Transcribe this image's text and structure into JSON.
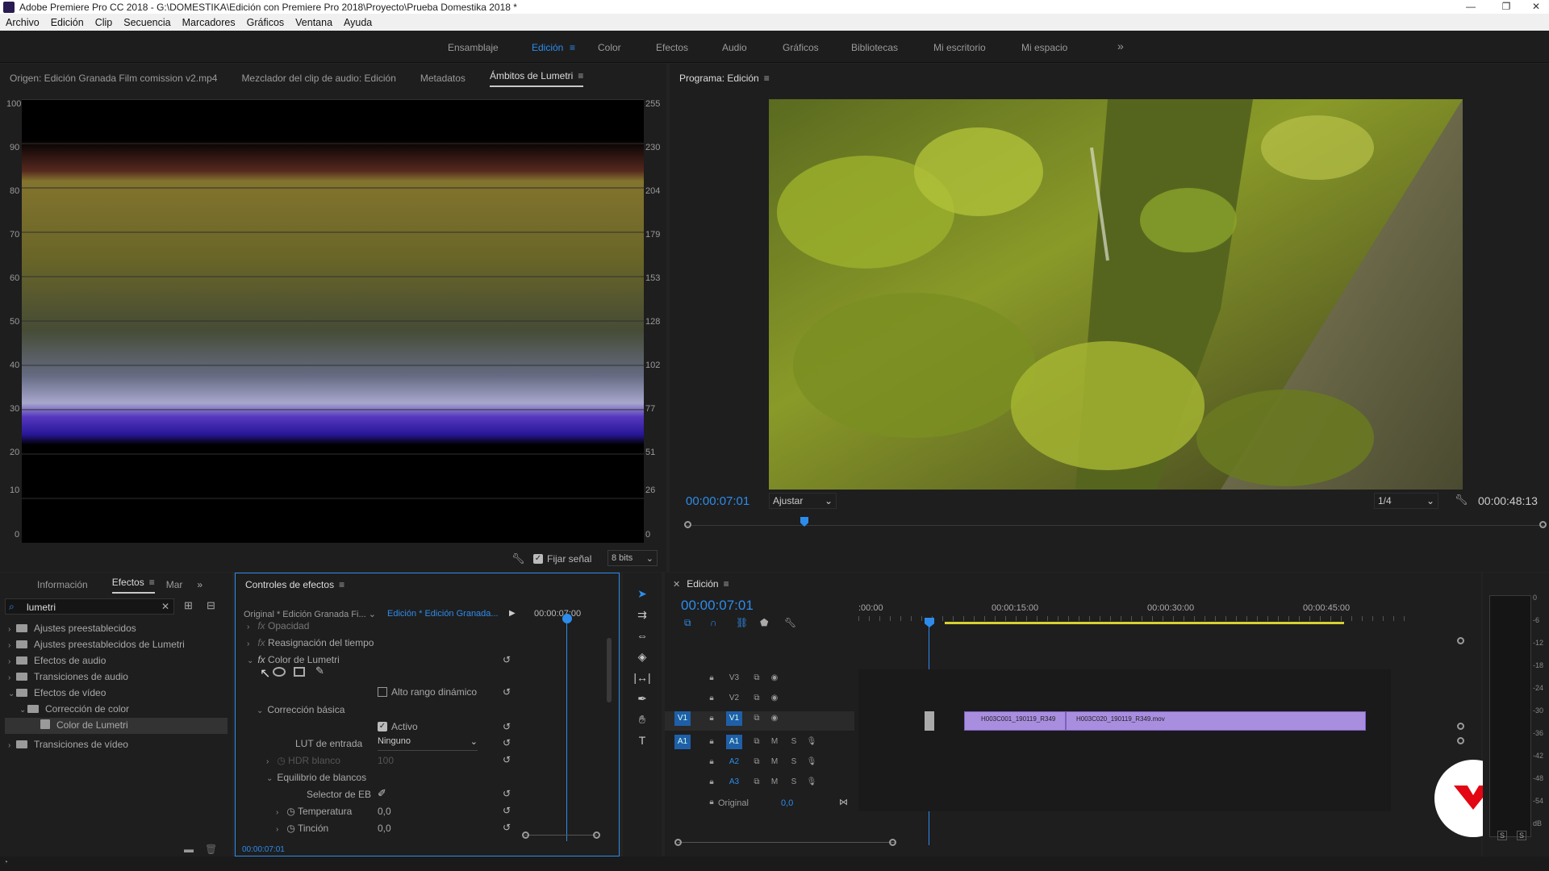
{
  "window": {
    "title": "Adobe Premiere Pro CC 2018 - G:\\DOMESTIKA\\Edición con Premiere Pro 2018\\Proyecto\\Prueba Domestika 2018 *",
    "controls": [
      "—",
      "❐",
      "✕"
    ]
  },
  "menu": [
    "Archivo",
    "Edición",
    "Clip",
    "Secuencia",
    "Marcadores",
    "Gráficos",
    "Ventana",
    "Ayuda"
  ],
  "workspaces": {
    "items": [
      "Ensamblaje",
      "Edición",
      "Color",
      "Efectos",
      "Audio",
      "Gráficos",
      "Bibliotecas",
      "Mi escritorio",
      "Mi espacio"
    ],
    "active": "Edición",
    "more": "»"
  },
  "source_panel": {
    "tabs": [
      "Origen: Edición Granada Film comission v2.mp4",
      "Mezclador del clip de audio: Edición",
      "Metadatos",
      "Ámbitos de Lumetri"
    ],
    "active_tab": "Ámbitos de Lumetri",
    "left_axis": [
      "100",
      "90",
      "80",
      "70",
      "60",
      "50",
      "40",
      "30",
      "20",
      "10",
      "0"
    ],
    "right_axis": [
      "255",
      "230",
      "204",
      "179",
      "153",
      "128",
      "102",
      "77",
      "51",
      "26",
      "0"
    ],
    "footer": {
      "clamp_label": "Fijar señal",
      "bits": "8 bits"
    }
  },
  "program_panel": {
    "title": "Programa: Edición",
    "timecode": "00:00:07:01",
    "fit": "Ajustar",
    "resolution": "1/4",
    "duration": "00:00:48:13"
  },
  "effects_panel": {
    "tabs": [
      "Información",
      "Efectos",
      "Mar"
    ],
    "active_tab": "Efectos",
    "search_value": "lumetri",
    "tree": [
      {
        "label": "Ajustes preestablecidos",
        "level": 0
      },
      {
        "label": "Ajustes preestablecidos de Lumetri",
        "level": 0
      },
      {
        "label": "Efectos de audio",
        "level": 0
      },
      {
        "label": "Transiciones de audio",
        "level": 0
      },
      {
        "label": "Efectos de vídeo",
        "level": 0,
        "open": true
      },
      {
        "label": "Corrección de color",
        "level": 1,
        "open": true
      },
      {
        "label": "Color de Lumetri",
        "level": 2,
        "selected": true
      },
      {
        "label": "Transiciones de vídeo",
        "level": 0
      }
    ]
  },
  "effect_controls": {
    "title": "Controles de efectos",
    "master": "Original * Edición Granada Fi...",
    "sequence": "Edición * Edición Granada...",
    "mini_time": "00:00:07:00",
    "rows": {
      "opacity": "Opacidad",
      "time_remap": "Reasignación del tiempo",
      "lumetri": "Color de Lumetri",
      "hdr": "Alto rango dinámico",
      "basic": "Corrección básica",
      "active": "Activo",
      "lut_label": "LUT de entrada",
      "lut_value": "Ninguno",
      "hdr_white": "HDR blanco",
      "hdr_white_value": "100",
      "wb": "Equilibrio de blancos",
      "wb_selector": "Selector de EB",
      "temp": "Temperatura",
      "temp_value": "0,0",
      "tint": "Tinción",
      "tint_value": "0,0"
    },
    "footer_time": "00:00:07:01"
  },
  "timeline": {
    "title": "Edición",
    "timecode": "00:00:07:01",
    "ruler": [
      ":00:00",
      "00:00:15:00",
      "00:00:30:00",
      "00:00:45:00"
    ],
    "video_tracks": [
      "V3",
      "V2",
      "V1"
    ],
    "audio_tracks": [
      "A1",
      "A2",
      "A3"
    ],
    "source_patch_v": "V1",
    "source_patch_a": "A1",
    "mix_label": "Original",
    "mix_value": "0,0",
    "clip1": "H003C001_190119_R349",
    "clip2": "H003C020_190119_R349.mov"
  },
  "audio_meter": {
    "scale": [
      "0",
      "-6",
      "-12",
      "-18",
      "-24",
      "-30",
      "-36",
      "-42",
      "-48",
      "-54",
      "dB"
    ],
    "solo": [
      "S",
      "S"
    ]
  },
  "colors": {
    "accent": "#2d8ceb",
    "clip": "#a98ee0",
    "brand": "#e30613"
  }
}
